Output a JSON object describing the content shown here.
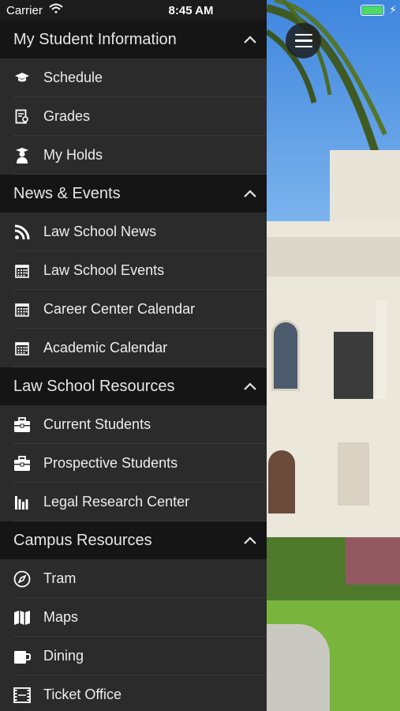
{
  "status_bar": {
    "carrier": "Carrier",
    "time": "8:45 AM"
  },
  "sections": [
    {
      "title": "My Student Information",
      "items": [
        {
          "label": "Schedule",
          "icon": "graduation-cap-icon"
        },
        {
          "label": "Grades",
          "icon": "certificate-icon"
        },
        {
          "label": "My Holds",
          "icon": "graduate-user-icon"
        }
      ]
    },
    {
      "title": "News & Events",
      "items": [
        {
          "label": "Law School News",
          "icon": "rss-icon"
        },
        {
          "label": "Law School Events",
          "icon": "calendar-icon"
        },
        {
          "label": "Career Center Calendar",
          "icon": "calendar-icon"
        },
        {
          "label": "Academic Calendar",
          "icon": "calendar-icon"
        }
      ]
    },
    {
      "title": "Law School Resources",
      "items": [
        {
          "label": "Current Students",
          "icon": "briefcase-icon"
        },
        {
          "label": "Prospective Students",
          "icon": "briefcase-icon"
        },
        {
          "label": "Legal Research Center",
          "icon": "library-icon"
        }
      ]
    },
    {
      "title": "Campus Resources",
      "items": [
        {
          "label": "Tram",
          "icon": "compass-icon"
        },
        {
          "label": "Maps",
          "icon": "map-icon"
        },
        {
          "label": "Dining",
          "icon": "mug-icon"
        },
        {
          "label": "Ticket Office",
          "icon": "film-icon"
        }
      ]
    }
  ]
}
